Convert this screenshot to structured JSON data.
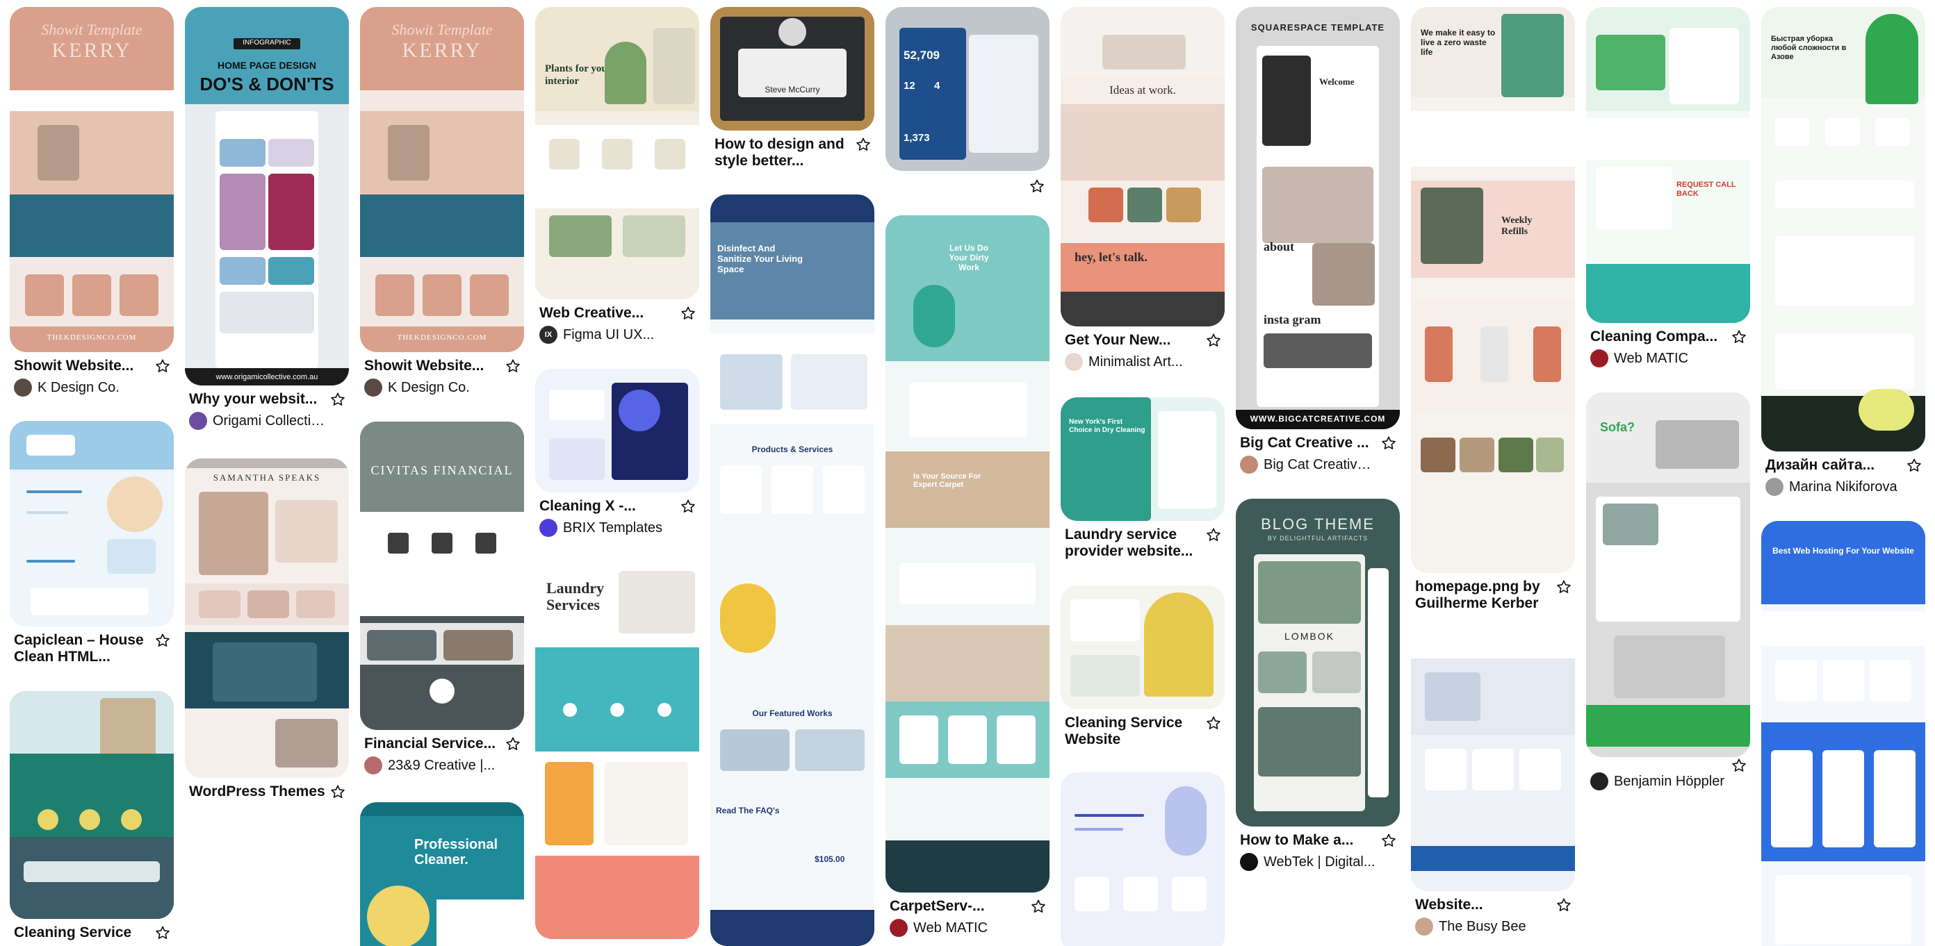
{
  "board": {
    "pins": [
      {
        "id": "p1",
        "title": "Showit Website...",
        "author": "K Design Co.",
        "avatar_color": "#5a4b42"
      },
      {
        "id": "p2",
        "title": "Capiclean – House Clean HTML...",
        "author": "",
        "avatar_color": ""
      },
      {
        "id": "p3",
        "title": "Cleaning Service",
        "author": "",
        "avatar_color": ""
      },
      {
        "id": "p4",
        "title": "Why your websit...",
        "author": "Origami Collectiv...",
        "avatar_color": "#6b4ea0"
      },
      {
        "id": "p5",
        "title": "WordPress Themes",
        "author": "",
        "avatar_color": ""
      },
      {
        "id": "p6",
        "title": "Showit Website...",
        "author": "K Design Co.",
        "avatar_color": "#5a4b42"
      },
      {
        "id": "p7",
        "title": "Financial Service...",
        "author": "23&9 Creative |...",
        "avatar_color": "#b86a6a"
      },
      {
        "id": "p8",
        "title": "",
        "author": "",
        "avatar_color": ""
      },
      {
        "id": "p9",
        "title": "Web Creative...",
        "author": "Figma UI UX...",
        "avatar_color": "#2b2b2b",
        "avatar_text": "IX"
      },
      {
        "id": "p10",
        "title": "Cleaning X -...",
        "author": "BRIX Templates",
        "avatar_color": "#4a3cdb"
      },
      {
        "id": "p11",
        "title": "",
        "author": "",
        "avatar_color": ""
      },
      {
        "id": "p12",
        "title": "How to design and style better...",
        "author": "",
        "avatar_color": ""
      },
      {
        "id": "p13",
        "title": "",
        "author": "",
        "avatar_color": ""
      },
      {
        "id": "p14",
        "title": "",
        "author": "",
        "avatar_color": ""
      },
      {
        "id": "p15",
        "title": "CarpetServ-...",
        "author": "Web MATIC",
        "avatar_color": "#9b1c24"
      },
      {
        "id": "p16",
        "title": "Get Your New...",
        "author": "Minimalist Art...",
        "avatar_color": "#e8d7cf"
      },
      {
        "id": "p17",
        "title": "Laundry service provider website...",
        "author": "",
        "avatar_color": ""
      },
      {
        "id": "p18",
        "title": "Cleaning Service Website",
        "author": "",
        "avatar_color": ""
      },
      {
        "id": "p19",
        "title": "",
        "author": "",
        "avatar_color": ""
      },
      {
        "id": "p20",
        "title": "Big Cat Creative ...",
        "author": "Big Cat Creative ...",
        "avatar_color": "#c08a76"
      },
      {
        "id": "p21",
        "title": "How to Make a...",
        "author": "WebTek | Digital...",
        "avatar_color": "#111111"
      },
      {
        "id": "p22",
        "title": "homepage.png by Guilherme Kerber",
        "author": "",
        "avatar_color": ""
      },
      {
        "id": "p23",
        "title": "Website...",
        "author": "The Busy Bee",
        "avatar_color": "#c9a58d"
      },
      {
        "id": "p24",
        "title": "Cleaning Compa...",
        "author": "Web MATIC",
        "avatar_color": "#9b1c24"
      },
      {
        "id": "p25",
        "title": "",
        "author": "Benjamin Höppler",
        "avatar_color": "#222222"
      },
      {
        "id": "p26",
        "title": "Дизайн сайта...",
        "author": "Marina Nikiforova",
        "avatar_color": "#9a9a9a"
      },
      {
        "id": "p27",
        "title": "",
        "author": "",
        "avatar_color": ""
      }
    ]
  },
  "thumb_text": {
    "p1_script": "Showit Template",
    "p1_name": "KERRY",
    "p1_footer": "THEKDESIGNCO.COM",
    "p4_tag": "INFOGRAPHIC",
    "p4_heading_1": "HOME PAGE DESIGN",
    "p4_heading_2": "DO'S & DON'TS",
    "p4_footer": "www.origamicollective.com.au",
    "p5_name": "SAMANTHA SPEAKS",
    "p7_name": "CIVITAS FINANCIAL",
    "p8_title_1": "Professional",
    "p8_title_2": "Cleaner.",
    "p9_heading": "Plants for your interior",
    "p11_heading_1": "Laundry",
    "p11_heading_2": "Services",
    "p12_quote_name": "Steve McCurry",
    "p13_heading": "Disinfect And Sanitize Your Living Space",
    "p13_subheading": "Products & Services",
    "p13_featured": "Our Featured Works",
    "p13_faq": "Read The FAQ's",
    "p13_price": "$105.00",
    "p14_stat_1": "52,709",
    "p14_stat_2": "1,373",
    "p14_stat_3": "12",
    "p14_stat_4": "4",
    "p15_heading": "Let Us Do Your Dirty Work",
    "p15_heading_2": "Is Your Source For Expert Carpet",
    "p16_heading": "Ideas at work.",
    "p16_heading_2": "hey, let's talk.",
    "p17_heading": "New York's First Choice in Dry Cleaning",
    "p20_tag": "SQUARESPACE TEMPLATE",
    "p20_welcome": "Welcome",
    "p20_about": "about",
    "p20_insta": "insta gram",
    "p20_footer": "WWW.BIGCATCREATIVE.COM",
    "p21_heading": "BLOG THEME",
    "p21_sub": "BY DELIGHTFUL ARTIFACTS",
    "p21_name": "LOMBOK",
    "p22_heading": "We make it easy to live a zero waste life",
    "p22_refills": "Weekly Refills",
    "p24_call": "REQUEST CALL BACK",
    "p25_heading": "Sofa?",
    "p26_heading": "Быстрая уборка любой сложности в Азове",
    "p27_heading": "Best Web Hosting For Your Website"
  },
  "colors": {
    "peach": "#d9a08b",
    "teal_dark": "#2a6b82",
    "sky": "#4a90c2",
    "green_brand": "#2fa84f",
    "coral": "#f08a78",
    "navy": "#1e3a6e",
    "save_icon": "#111111"
  }
}
